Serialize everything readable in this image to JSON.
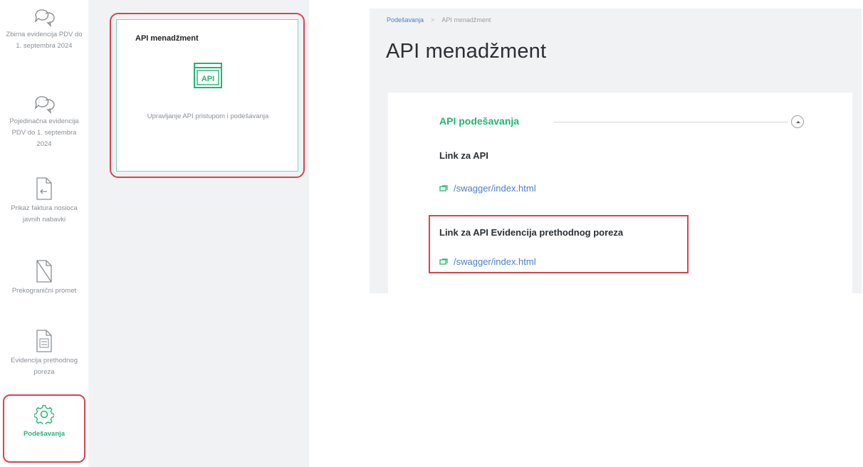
{
  "sidebar": {
    "items": [
      {
        "icon": "chat-bubbles-icon",
        "label": "Zbirna evidencija PDV do 1. septembra 2024",
        "active": false
      },
      {
        "icon": "chat-bubbles-icon",
        "label": "Pojedinačna evidencija PDV do 1. septembra 2024",
        "active": false
      },
      {
        "icon": "document-arrow-icon",
        "label": "Prikaz faktura nosioca javnih nabavki",
        "active": false
      },
      {
        "icon": "crossed-document-icon",
        "label": "Prekogranični promet",
        "active": false
      },
      {
        "icon": "ppp-pdv-document-icon",
        "label": "Evidencija prethodnog poreza",
        "active": false
      },
      {
        "icon": "gear-icon",
        "label": "Podešavanja",
        "active": true
      }
    ]
  },
  "api_card": {
    "title": "API menadžment",
    "icon_text": "API",
    "description": "Upravljanje API pristupom i podešavanja"
  },
  "breadcrumb": {
    "items": [
      "Podešavanja",
      "API menadžment"
    ],
    "separator": ">"
  },
  "page": {
    "title": "API menadžment"
  },
  "api_settings": {
    "section_title": "API podešavanja",
    "fields": [
      {
        "label": "Link za API",
        "link_text": "/swagger/index.html"
      },
      {
        "label": "Link za API Evidencija prethodnog poreza",
        "link_text": "/swagger/index.html"
      }
    ]
  },
  "colors": {
    "accent_green": "#22b573",
    "link_blue": "#4a7fc8",
    "highlight_red": "#d9434f",
    "panel_gray": "#f1f2f4"
  }
}
